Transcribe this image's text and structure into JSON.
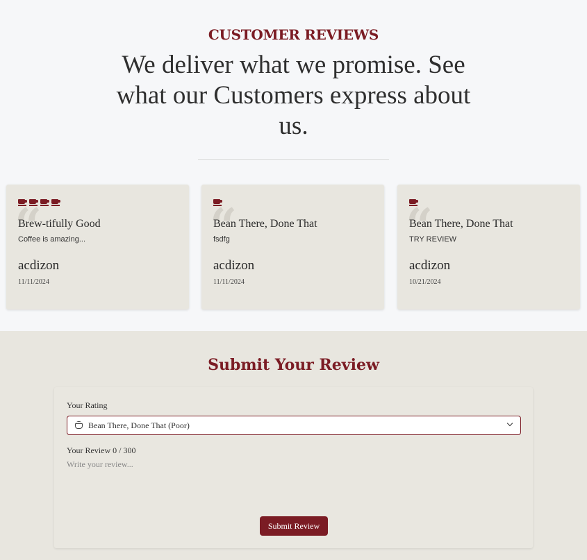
{
  "hero": {
    "eyebrow": "CUSTOMER REVIEWS",
    "headline": "We deliver what we promise. See what our Customers express about us."
  },
  "reviews": [
    {
      "cups": 4,
      "title": "Brew-tifully Good",
      "text": "Coffee is amazing...",
      "user": "acdizon",
      "date": "11/11/2024"
    },
    {
      "cups": 1,
      "title": "Bean There, Done That",
      "text": "fsdfg",
      "user": "acdizon",
      "date": "11/11/2024"
    },
    {
      "cups": 1,
      "title": "Bean There, Done That",
      "text": "TRY REVIEW",
      "user": "acdizon",
      "date": "10/21/2024"
    }
  ],
  "form": {
    "title": "Submit Your Review",
    "rating_label": "Your Rating",
    "rating_value": "Bean There, Done That (Poor)",
    "review_label": "Your Review 0 / 300",
    "review_placeholder": "Write your review...",
    "review_value": "",
    "submit_label": "Submit Review"
  },
  "colors": {
    "accent": "#7b1c24",
    "card_bg": "#e8e6df",
    "page_bg": "#f6f7f9"
  },
  "icons": {
    "rating_cup": "coffee-cup-icon",
    "quote": "quote-icon",
    "select_icon": "coffee-mug-icon",
    "chevron": "chevron-down-icon"
  }
}
